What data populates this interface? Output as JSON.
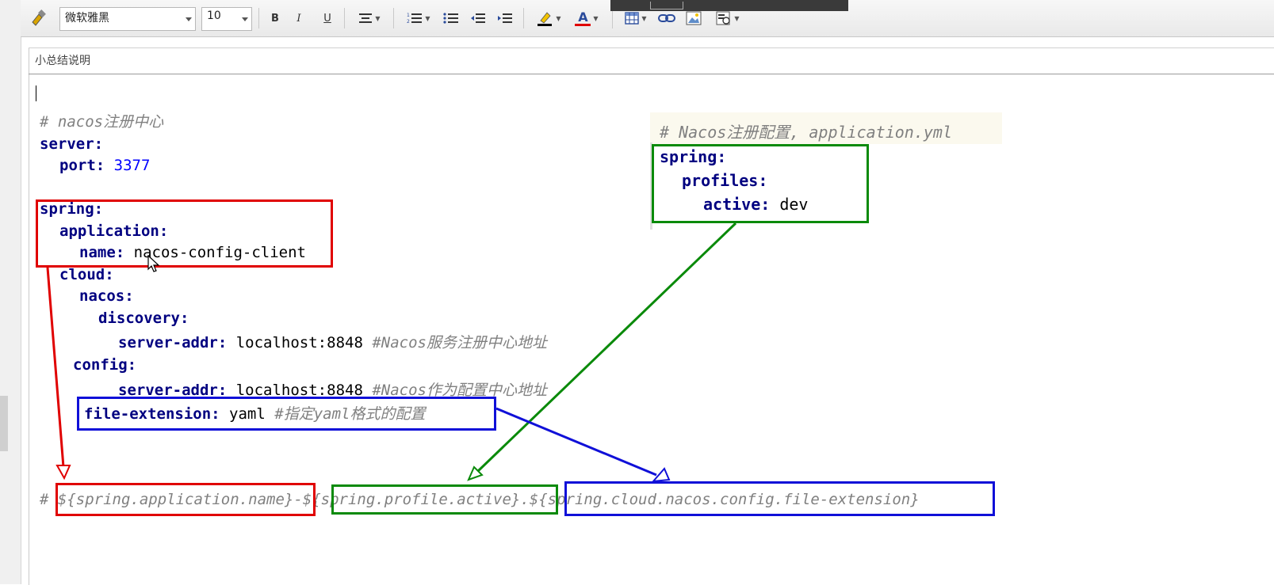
{
  "toolbar": {
    "font_family": "微软雅黑",
    "font_size": "10",
    "bold": "B",
    "italic": "I",
    "underline": "U",
    "font_color_glyph": "A"
  },
  "editor": {
    "title": "小总结说明",
    "code_lines": [
      {
        "comment": "# nacos注册中心"
      },
      {
        "key": "server:"
      },
      {
        "key": "port:",
        "value": "3377"
      },
      {
        "key": "spring:"
      },
      {
        "key": "application:"
      },
      {
        "key": "name:",
        "value": "nacos-config-client"
      },
      {
        "key": "cloud:"
      },
      {
        "key": "nacos:"
      },
      {
        "key": "discovery:"
      },
      {
        "key": "server-addr:",
        "value": "localhost:8848",
        "comment": "#Nacos服务注册中心地址"
      },
      {
        "key": "config:"
      },
      {
        "key": "server-addr:",
        "value": "localhost:8848",
        "comment": "#Nacos作为配置中心地址"
      },
      {
        "key": "file-extension:",
        "value": "yaml",
        "comment": "#指定yaml格式的配置"
      }
    ],
    "formula": {
      "hash": "#",
      "part1": "${spring.application.name}",
      "sep1": "-",
      "part2": "${spring.profile.active}",
      "sep2": ".",
      "part3": "${spring.cloud.nacos.config.file-extension}"
    }
  },
  "snippet": {
    "comment": "# Nacos注册配置, application.yml",
    "lines": [
      {
        "key": "spring:"
      },
      {
        "key": "profiles:"
      },
      {
        "key": "active:",
        "value": "dev"
      }
    ]
  },
  "colors": {
    "red": "#e00000",
    "green": "#0a8a0a",
    "blue": "#1010d8",
    "key": "#000080",
    "number": "#0000ff",
    "comment": "#808080"
  }
}
